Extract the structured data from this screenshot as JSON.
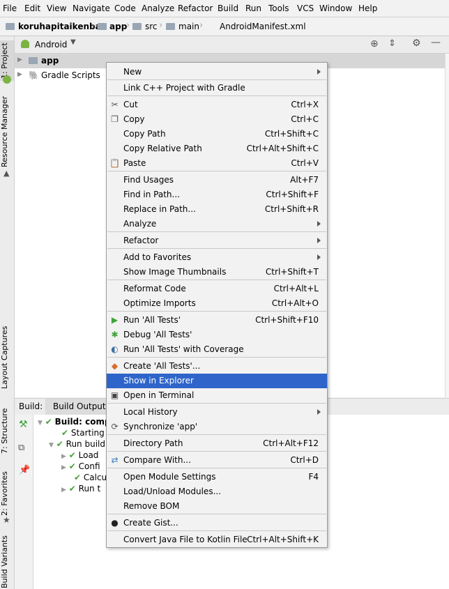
{
  "menubar": [
    "File",
    "Edit",
    "View",
    "Navigate",
    "Code",
    "Analyze",
    "Refactor",
    "Build",
    "Run",
    "Tools",
    "VCS",
    "Window",
    "Help"
  ],
  "breadcrumb": [
    "koruhapitaikenban",
    "app",
    "src",
    "main",
    "AndroidManifest.xml"
  ],
  "left_tabs": {
    "project": "1: Project",
    "resource_manager": "Resource Manager",
    "layout_captures": "Layout Captures",
    "structure": "7: Structure",
    "favorites": "2: Favorites",
    "build_variants": "Build Variants"
  },
  "project_panel": {
    "view_selector": "Android",
    "tree": [
      "app",
      "Gradle Scripts"
    ]
  },
  "build_panel": {
    "tabs": [
      "Build:",
      "Build Output"
    ],
    "rows": [
      "Build: comp",
      "Starting",
      "Run build",
      "Load",
      "Confi",
      "Calcu",
      "Run t"
    ]
  },
  "context_menu": {
    "items": [
      {
        "label": "New",
        "shortcut": "",
        "submenu": true,
        "icon": ""
      },
      {
        "label": "Link C++ Project with Gradle",
        "shortcut": "",
        "submenu": false,
        "icon": ""
      },
      {
        "label": "Cut",
        "shortcut": "Ctrl+X",
        "submenu": false,
        "icon": "scissors-icon"
      },
      {
        "label": "Copy",
        "shortcut": "Ctrl+C",
        "submenu": false,
        "icon": "copy-icon"
      },
      {
        "label": "Copy Path",
        "shortcut": "Ctrl+Shift+C",
        "submenu": false,
        "icon": ""
      },
      {
        "label": "Copy Relative Path",
        "shortcut": "Ctrl+Alt+Shift+C",
        "submenu": false,
        "icon": ""
      },
      {
        "label": "Paste",
        "shortcut": "Ctrl+V",
        "submenu": false,
        "icon": "clipboard-icon"
      },
      {
        "label": "Find Usages",
        "shortcut": "Alt+F7",
        "submenu": false,
        "icon": ""
      },
      {
        "label": "Find in Path...",
        "shortcut": "Ctrl+Shift+F",
        "submenu": false,
        "icon": ""
      },
      {
        "label": "Replace in Path...",
        "shortcut": "Ctrl+Shift+R",
        "submenu": false,
        "icon": ""
      },
      {
        "label": "Analyze",
        "shortcut": "",
        "submenu": true,
        "icon": ""
      },
      {
        "label": "Refactor",
        "shortcut": "",
        "submenu": true,
        "icon": ""
      },
      {
        "label": "Add to Favorites",
        "shortcut": "",
        "submenu": true,
        "icon": ""
      },
      {
        "label": "Show Image Thumbnails",
        "shortcut": "Ctrl+Shift+T",
        "submenu": false,
        "icon": ""
      },
      {
        "label": "Reformat Code",
        "shortcut": "Ctrl+Alt+L",
        "submenu": false,
        "icon": ""
      },
      {
        "label": "Optimize Imports",
        "shortcut": "Ctrl+Alt+O",
        "submenu": false,
        "icon": ""
      },
      {
        "label": "Run 'All Tests'",
        "shortcut": "Ctrl+Shift+F10",
        "submenu": false,
        "icon": "run-icon"
      },
      {
        "label": "Debug 'All Tests'",
        "shortcut": "",
        "submenu": false,
        "icon": "debug-icon"
      },
      {
        "label": "Run 'All Tests' with Coverage",
        "shortcut": "",
        "submenu": false,
        "icon": "coverage-icon"
      },
      {
        "label": "Create 'All Tests'...",
        "shortcut": "",
        "submenu": false,
        "icon": "create-test-icon"
      },
      {
        "label": "Show in Explorer",
        "shortcut": "",
        "submenu": false,
        "icon": "",
        "selected": true
      },
      {
        "label": "Open in Terminal",
        "shortcut": "",
        "submenu": false,
        "icon": "terminal-icon"
      },
      {
        "label": "Local History",
        "shortcut": "",
        "submenu": true,
        "icon": ""
      },
      {
        "label": "Synchronize 'app'",
        "shortcut": "",
        "submenu": false,
        "icon": "sync-icon"
      },
      {
        "label": "Directory Path",
        "shortcut": "Ctrl+Alt+F12",
        "submenu": false,
        "icon": ""
      },
      {
        "label": "Compare With...",
        "shortcut": "Ctrl+D",
        "submenu": false,
        "icon": "compare-icon"
      },
      {
        "label": "Open Module Settings",
        "shortcut": "F4",
        "submenu": false,
        "icon": ""
      },
      {
        "label": "Load/Unload Modules...",
        "shortcut": "",
        "submenu": false,
        "icon": ""
      },
      {
        "label": "Remove BOM",
        "shortcut": "",
        "submenu": false,
        "icon": ""
      },
      {
        "label": "Create Gist...",
        "shortcut": "",
        "submenu": false,
        "icon": "github-icon"
      },
      {
        "label": "Convert Java File to Kotlin File",
        "shortcut": "Ctrl+Alt+Shift+K",
        "submenu": false,
        "icon": ""
      }
    ]
  },
  "colors": {
    "selection": "#2f65ca",
    "check": "#4a9d3a",
    "run_green": "#3fa33a",
    "android_green": "#7cb342"
  }
}
